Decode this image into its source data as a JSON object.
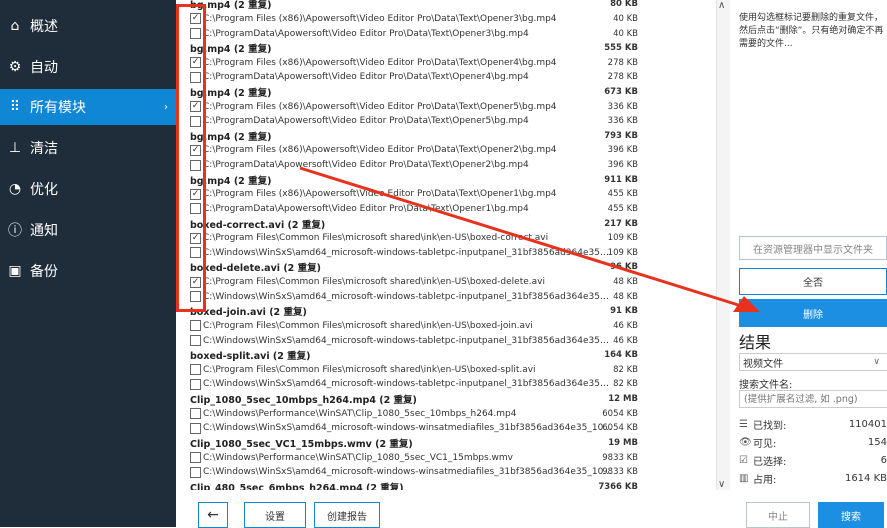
{
  "sidebar": {
    "items": [
      {
        "label": "概述",
        "icon": "home-icon",
        "glyph": "⌂"
      },
      {
        "label": "自动",
        "icon": "gears-icon",
        "glyph": "⚙"
      },
      {
        "label": "所有模块",
        "icon": "grid-icon",
        "glyph": "⠿",
        "active": true,
        "arrow": "›"
      },
      {
        "label": "清洁",
        "icon": "broom-icon",
        "glyph": "⊥"
      },
      {
        "label": "优化",
        "icon": "speedometer-icon",
        "glyph": "◔"
      },
      {
        "label": "通知",
        "icon": "info-icon",
        "glyph": "ⓘ"
      },
      {
        "label": "备份",
        "icon": "backup-icon",
        "glyph": "▣"
      }
    ]
  },
  "list": {
    "rows": [
      {
        "type": "group",
        "name": "bg.mp4 (2 重复)",
        "size": "80 KB"
      },
      {
        "type": "file",
        "checked": true,
        "path": "C:\\Program Files (x86)\\Apowersoft\\Video Editor Pro\\Data\\Text\\Opener3\\bg.mp4",
        "size": "40 KB"
      },
      {
        "type": "file",
        "checked": false,
        "path": "C:\\ProgramData\\Apowersoft\\Video Editor Pro\\Data\\Text\\Opener3\\bg.mp4",
        "size": "40 KB"
      },
      {
        "type": "group",
        "name": "bg.mp4 (2 重复)",
        "size": "555 KB"
      },
      {
        "type": "file",
        "checked": true,
        "path": "C:\\Program Files (x86)\\Apowersoft\\Video Editor Pro\\Data\\Text\\Opener4\\bg.mp4",
        "size": "278 KB"
      },
      {
        "type": "file",
        "checked": false,
        "path": "C:\\ProgramData\\Apowersoft\\Video Editor Pro\\Data\\Text\\Opener4\\bg.mp4",
        "size": "278 KB"
      },
      {
        "type": "group",
        "name": "bg.mp4 (2 重复)",
        "size": "673 KB"
      },
      {
        "type": "file",
        "checked": true,
        "path": "C:\\Program Files (x86)\\Apowersoft\\Video Editor Pro\\Data\\Text\\Opener5\\bg.mp4",
        "size": "336 KB"
      },
      {
        "type": "file",
        "checked": false,
        "path": "C:\\ProgramData\\Apowersoft\\Video Editor Pro\\Data\\Text\\Opener5\\bg.mp4",
        "size": "336 KB"
      },
      {
        "type": "group",
        "name": "bg.mp4 (2 重复)",
        "size": "793 KB"
      },
      {
        "type": "file",
        "checked": true,
        "path": "C:\\Program Files (x86)\\Apowersoft\\Video Editor Pro\\Data\\Text\\Opener2\\bg.mp4",
        "size": "396 KB"
      },
      {
        "type": "file",
        "checked": false,
        "path": "C:\\ProgramData\\Apowersoft\\Video Editor Pro\\Data\\Text\\Opener2\\bg.mp4",
        "size": "396 KB"
      },
      {
        "type": "group",
        "name": "bg.mp4 (2 重复)",
        "size": "911 KB"
      },
      {
        "type": "file",
        "checked": true,
        "path": "C:\\Program Files (x86)\\Apowersoft\\Video Editor Pro\\Data\\Text\\Opener1\\bg.mp4",
        "size": "455 KB"
      },
      {
        "type": "file",
        "checked": false,
        "path": "C:\\ProgramData\\Apowersoft\\Video Editor Pro\\Data\\Text\\Opener1\\bg.mp4",
        "size": "455 KB"
      },
      {
        "type": "group",
        "name": "boxed-correct.avi (2 重复)",
        "size": "217 KB"
      },
      {
        "type": "file",
        "checked": true,
        "path": "C:\\Program Files\\Common Files\\microsoft shared\\ink\\en-US\\boxed-correct.avi",
        "size": "109 KB"
      },
      {
        "type": "file",
        "checked": false,
        "path": "C:\\Windows\\WinSxS\\amd64_microsoft-windows-tabletpc-inputpanel_31bf3856ad364e35_10.0.1024...",
        "size": "109 KB"
      },
      {
        "type": "group",
        "name": "boxed-delete.avi (2 重复)",
        "size": "96 KB"
      },
      {
        "type": "file",
        "checked": true,
        "path": "C:\\Program Files\\Common Files\\microsoft shared\\ink\\en-US\\boxed-delete.avi",
        "size": "48 KB"
      },
      {
        "type": "file",
        "checked": false,
        "path": "C:\\Windows\\WinSxS\\amd64_microsoft-windows-tabletpc-inputpanel_31bf3856ad364e35_10.0.1024...",
        "size": "48 KB"
      },
      {
        "type": "group",
        "name": "boxed-join.avi (2 重复)",
        "size": "91 KB"
      },
      {
        "type": "file",
        "checked": false,
        "path": "C:\\Program Files\\Common Files\\microsoft shared\\ink\\en-US\\boxed-join.avi",
        "size": "46 KB"
      },
      {
        "type": "file",
        "checked": false,
        "path": "C:\\Windows\\WinSxS\\amd64_microsoft-windows-tabletpc-inputpanel_31bf3856ad364e35_10.0.1024...",
        "size": "46 KB"
      },
      {
        "type": "group",
        "name": "boxed-split.avi (2 重复)",
        "size": "164 KB"
      },
      {
        "type": "file",
        "checked": false,
        "path": "C:\\Program Files\\Common Files\\microsoft shared\\ink\\en-US\\boxed-split.avi",
        "size": "82 KB"
      },
      {
        "type": "file",
        "checked": false,
        "path": "C:\\Windows\\WinSxS\\amd64_microsoft-windows-tabletpc-inputpanel_31bf3856ad364e35_10.0.1024...",
        "size": "82 KB"
      },
      {
        "type": "group",
        "name": "Clip_1080_5sec_10mbps_h264.mp4 (2 重复)",
        "size": "12 MB"
      },
      {
        "type": "file",
        "checked": false,
        "path": "C:\\Windows\\Performance\\WinSAT\\Clip_1080_5sec_10mbps_h264.mp4",
        "size": "6054 KB"
      },
      {
        "type": "file",
        "checked": false,
        "path": "C:\\Windows\\WinSxS\\amd64_microsoft-windows-winsatmediafiles_31bf3856ad364e35_10.0.10240.1...",
        "size": "6054 KB"
      },
      {
        "type": "group",
        "name": "Clip_1080_5sec_VC1_15mbps.wmv (2 重复)",
        "size": "19 MB"
      },
      {
        "type": "file",
        "checked": false,
        "path": "C:\\Windows\\Performance\\WinSAT\\Clip_1080_5sec_VC1_15mbps.wmv",
        "size": "9833 KB"
      },
      {
        "type": "file",
        "checked": false,
        "path": "C:\\Windows\\WinSxS\\amd64_microsoft-windows-winsatmediafiles_31bf3856ad364e35_10.0.10240.1...",
        "size": "9833 KB"
      },
      {
        "type": "group",
        "name": "Clip_480_5sec_6mbps_h264.mp4 (2 重复)",
        "size": "7366 KB"
      }
    ]
  },
  "right": {
    "hint": "使用勾选框标记要删除的重复文件，然后点击“删除”。只有绝对确定不再需要的文件...",
    "show_in_explorer": "在资源管理器中显示文件夹",
    "select_none": "全否",
    "delete": "删除",
    "results_title": "结果",
    "file_type": "视频文件",
    "filter_label": "搜索文件名:",
    "filter_placeholder": "(提供扩展名过滤, 如 .png)",
    "stats": [
      {
        "icon": "list-icon",
        "glyph": "☰",
        "label": "已找到:",
        "value": "110401"
      },
      {
        "icon": "eye-icon",
        "glyph": "👁",
        "label": "可见:",
        "value": "154"
      },
      {
        "icon": "check-icon",
        "glyph": "☑",
        "label": "已选择:",
        "value": "6"
      },
      {
        "icon": "bar-chart-icon",
        "glyph": "▥",
        "label": "占用:",
        "value": "1614 KB"
      }
    ]
  },
  "bottom": {
    "back": "←",
    "settings": "设置",
    "create_report": "创建报告",
    "stop": "中止",
    "search": "搜索"
  },
  "colors": {
    "annotation": "#e8321e",
    "accent": "#1d8fe3",
    "sidebar": "#1f2d3b"
  }
}
